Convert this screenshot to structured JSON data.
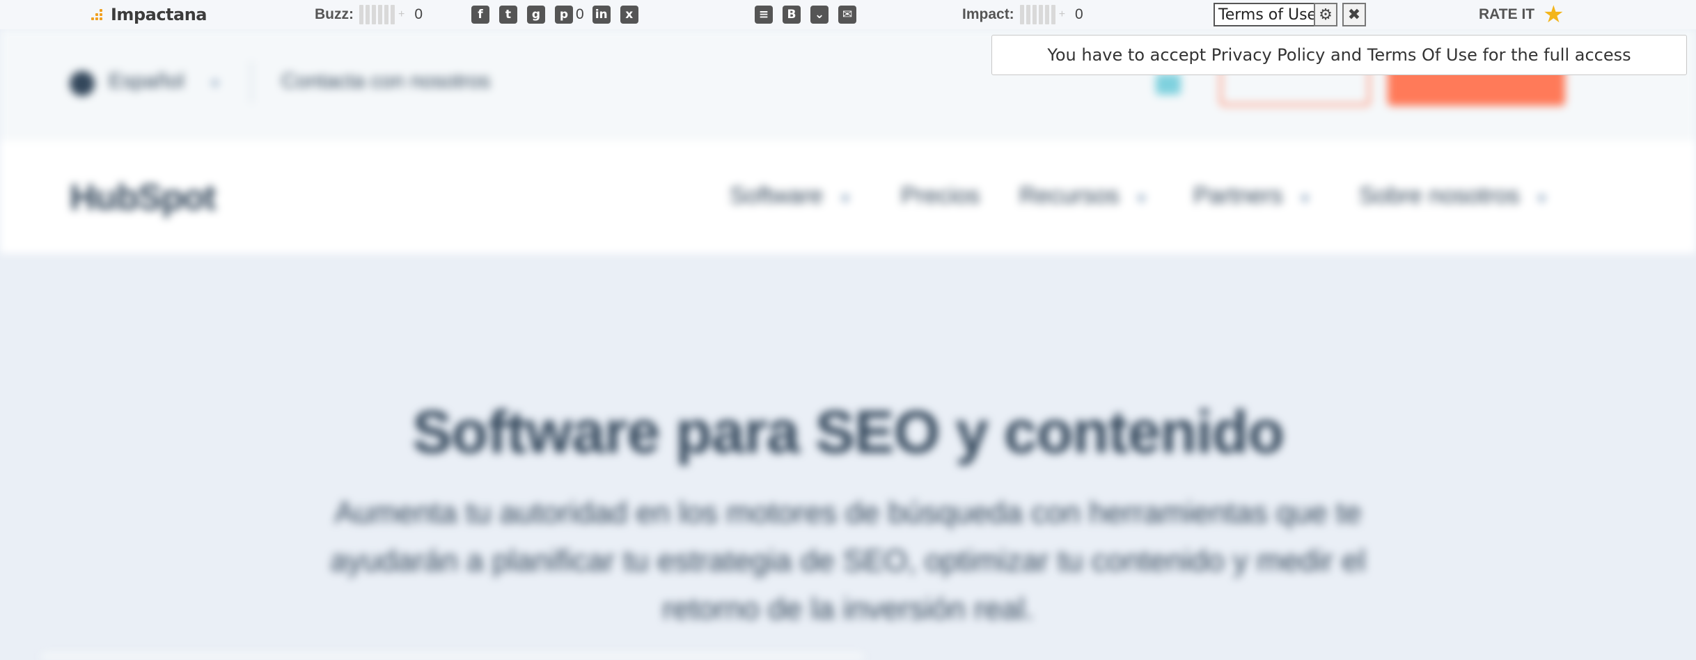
{
  "toolbar": {
    "logo_text": "Impactana",
    "buzz_label": "Buzz:",
    "buzz_count": "0",
    "social_icons": [
      "facebook-icon",
      "twitter-icon",
      "google-plus-icon",
      "pinterest-icon",
      "linkedin-icon",
      "xing-icon"
    ],
    "pinterest_count": "0",
    "save_icons": [
      "buffer-icon",
      "hatena-icon",
      "pocket-icon",
      "email-icon"
    ],
    "impact_label": "Impact:",
    "impact_count": "0",
    "terms_label": "Terms of Use",
    "rate_label": "RATE IT",
    "accent_color": "#f0a020",
    "star_color": "#f3b51b"
  },
  "notice": {
    "text": "You have to accept Privacy Policy and Terms Of Use for the full access"
  },
  "page": {
    "language": "Español",
    "contact": "Contacta con nosotros",
    "logo": "HubSpot",
    "nav": [
      "Software",
      "Precios",
      "Recursos",
      "Partners",
      "Sobre nosotros"
    ],
    "hero_title": "Software para SEO y contenido",
    "hero_subtitle": "Aumenta tu autoridad en los motores de búsqueda con herramientas que te ayudarán a planificar tu estrategia de SEO, optimizar tu contenido y medir el retorno de la inversión real.",
    "brand_color": "#ff7a59"
  }
}
